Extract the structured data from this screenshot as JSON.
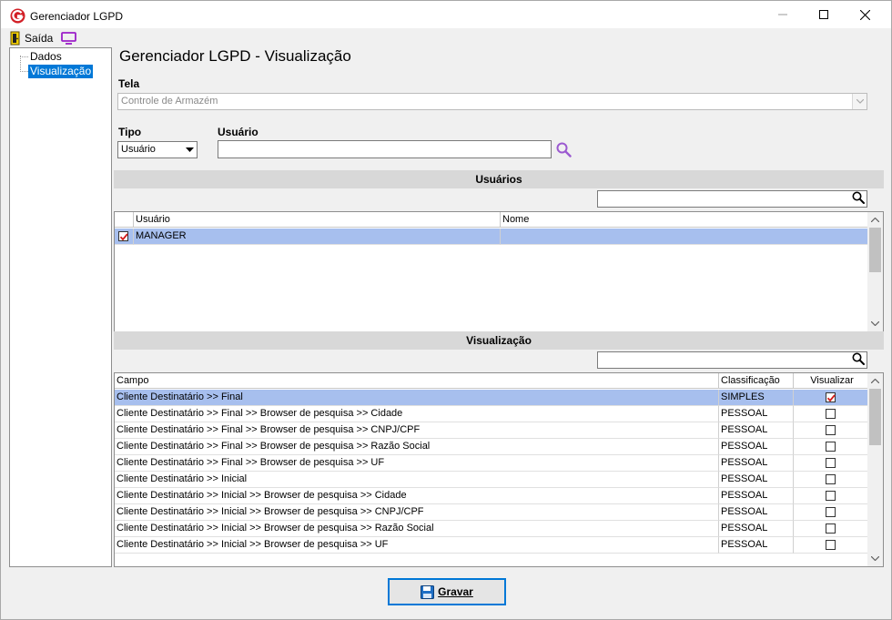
{
  "window": {
    "title": "Gerenciador LGPD"
  },
  "toolbar": {
    "exit_label": "Saída"
  },
  "tree": {
    "items": [
      {
        "label": "Dados",
        "selected": false
      },
      {
        "label": "Visualização",
        "selected": true
      }
    ]
  },
  "main": {
    "page_title": "Gerenciador LGPD - Visualização",
    "tela_label": "Tela",
    "tela_value": "Controle de Armazém",
    "tipo_label": "Tipo",
    "tipo_value": "Usuário",
    "usuario_label": "Usuário",
    "usuario_value": ""
  },
  "usuarios_section": {
    "header": "Usuários",
    "search_value": "",
    "columns": [
      "Usuário",
      "Nome"
    ],
    "rows": [
      {
        "checked": true,
        "usuario": "MANAGER",
        "nome": "",
        "selected": true
      }
    ]
  },
  "visualizacao_section": {
    "header": "Visualização",
    "search_value": "",
    "columns": [
      "Campo",
      "Classificação",
      "Visualizar"
    ],
    "rows": [
      {
        "campo": "Cliente Destinatário >> Final",
        "classificacao": "SIMPLES",
        "visualizar": true,
        "selected": true
      },
      {
        "campo": "Cliente Destinatário >> Final >> Browser de pesquisa >> Cidade",
        "classificacao": "PESSOAL",
        "visualizar": false,
        "selected": false
      },
      {
        "campo": "Cliente Destinatário >> Final >> Browser de pesquisa >> CNPJ/CPF",
        "classificacao": "PESSOAL",
        "visualizar": false,
        "selected": false
      },
      {
        "campo": "Cliente Destinatário >> Final >> Browser de pesquisa >> Razão Social",
        "classificacao": "PESSOAL",
        "visualizar": false,
        "selected": false
      },
      {
        "campo": "Cliente Destinatário >> Final >> Browser de pesquisa >> UF",
        "classificacao": "PESSOAL",
        "visualizar": false,
        "selected": false
      },
      {
        "campo": "Cliente Destinatário >> Inicial",
        "classificacao": "PESSOAL",
        "visualizar": false,
        "selected": false
      },
      {
        "campo": "Cliente Destinatário >> Inicial >> Browser de pesquisa >> Cidade",
        "classificacao": "PESSOAL",
        "visualizar": false,
        "selected": false
      },
      {
        "campo": "Cliente Destinatário >> Inicial >> Browser de pesquisa >> CNPJ/CPF",
        "classificacao": "PESSOAL",
        "visualizar": false,
        "selected": false
      },
      {
        "campo": "Cliente Destinatário >> Inicial >> Browser de pesquisa >> Razão Social",
        "classificacao": "PESSOAL",
        "visualizar": false,
        "selected": false
      },
      {
        "campo": "Cliente Destinatário >> Inicial >> Browser de pesquisa >> UF",
        "classificacao": "PESSOAL",
        "visualizar": false,
        "selected": false
      }
    ]
  },
  "footer": {
    "save_label": "Gravar"
  },
  "colors": {
    "selection_row": "#a7bfee",
    "tree_selection": "#0078d7",
    "check_mark": "#d11a1a",
    "search_icon_purple": "#9b59d0"
  }
}
